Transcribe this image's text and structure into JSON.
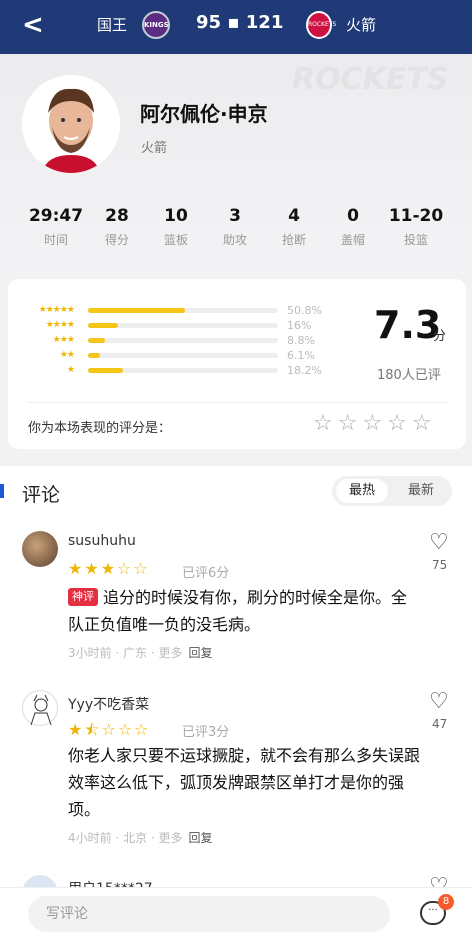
{
  "header": {
    "back_icon": "chevron-left-icon",
    "home_team": "国王",
    "home_logo_text": "KINGS",
    "score": "95 ▪ 121",
    "away_logo_text": "ROCKETS",
    "away_team": "火箭"
  },
  "player": {
    "watermark": "ROCKETS",
    "name": "阿尔佩伦·申京",
    "team": "火箭"
  },
  "stats": [
    {
      "value": "29:47",
      "label": "时间"
    },
    {
      "value": "28",
      "label": "得分"
    },
    {
      "value": "10",
      "label": "篮板"
    },
    {
      "value": "3",
      "label": "助攻"
    },
    {
      "value": "4",
      "label": "抢断"
    },
    {
      "value": "0",
      "label": "盖帽"
    },
    {
      "value": "11-20",
      "label": "投篮"
    }
  ],
  "rating": {
    "distribution": [
      {
        "stars": 5,
        "label": "★★★★★",
        "percent": "50.8%",
        "fraction": 0.508
      },
      {
        "stars": 4,
        "label": "★★★★",
        "percent": "16%",
        "fraction": 0.16
      },
      {
        "stars": 3,
        "label": "★★★",
        "percent": "8.8%",
        "fraction": 0.088
      },
      {
        "stars": 2,
        "label": "★★",
        "percent": "6.1%",
        "fraction": 0.061
      },
      {
        "stars": 1,
        "label": "★",
        "percent": "18.2%",
        "fraction": 0.182
      }
    ],
    "score": "7.3",
    "unit": "分",
    "raters": "180人已评",
    "prompt": "你为本场表现的评分是：",
    "rate_stars": "☆☆☆☆☆"
  },
  "comments_section": {
    "title": "评论",
    "sort_hot": "最热",
    "sort_new": "最新"
  },
  "comments": [
    {
      "user": "susuhuhu",
      "stars": "★★★☆☆",
      "star_count": 3,
      "rated": "已评6分",
      "badge": "神评",
      "text": "追分的时候没有你，刷分的时候全是你。全队正负值唯一负的没毛病。",
      "meta": "3小时前 · 广东 · 更多",
      "reply": "回复",
      "likes": "75"
    },
    {
      "user": "Yyy不吃香菜",
      "stars": "★⯪☆☆☆",
      "star_count": 1.5,
      "rated": "已评3分",
      "badge": "",
      "text": "你老人家只要不运球撅腚，就不会有那么多失误跟效率这么低下，弧顶发牌跟禁区单打才是你的强项。",
      "meta": "4小时前 · 北京 · 更多",
      "reply": "回复",
      "likes": "47"
    },
    {
      "user": "用户15***27",
      "partial": true
    }
  ],
  "bottom": {
    "placeholder": "写评论",
    "chat_icon": "chat-bubble-icon",
    "badge_count": "8"
  },
  "colors": {
    "header_bg": "#203a78",
    "accent_star": "#f0b500",
    "badge_red": "#e62e41"
  }
}
